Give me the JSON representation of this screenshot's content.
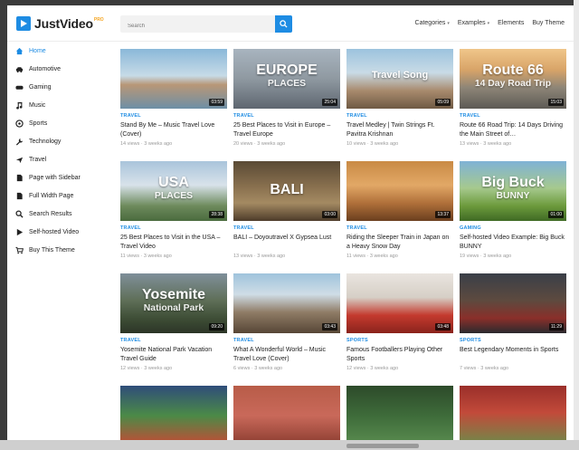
{
  "brand": {
    "name": "JustVideo",
    "badge": "PRO"
  },
  "search": {
    "placeholder": "Search"
  },
  "topnav": [
    {
      "label": "Categories",
      "dropdown": true
    },
    {
      "label": "Examples",
      "dropdown": true
    },
    {
      "label": "Elements",
      "dropdown": false
    },
    {
      "label": "Buy Theme",
      "dropdown": false
    }
  ],
  "sidebar": {
    "items": [
      {
        "label": "Home",
        "icon": "home-icon",
        "active": true
      },
      {
        "label": "Automotive",
        "icon": "car-icon"
      },
      {
        "label": "Gaming",
        "icon": "gamepad-icon"
      },
      {
        "label": "Music",
        "icon": "music-note-icon"
      },
      {
        "label": "Sports",
        "icon": "ball-icon"
      },
      {
        "label": "Technology",
        "icon": "wrench-icon"
      },
      {
        "label": "Travel",
        "icon": "plane-icon"
      },
      {
        "label": "Page with Sidebar",
        "icon": "document-icon"
      },
      {
        "label": "Full Width Page",
        "icon": "document-icon"
      },
      {
        "label": "Search Results",
        "icon": "search-icon"
      },
      {
        "label": "Self-hosted Video",
        "icon": "play-icon"
      },
      {
        "label": "Buy This Theme",
        "icon": "cart-icon"
      }
    ]
  },
  "videos": [
    {
      "category": "TRAVEL",
      "title": "Stand By Me – Music Travel Love (Cover)",
      "meta": "14 views · 3 weeks ago",
      "duration": "03:59",
      "bg": "linear-gradient(180deg,#8ab8d9 0%,#c7dbe7 45%,#b89777 60%,#6d8fa6 100%)",
      "overlay": ""
    },
    {
      "category": "TRAVEL",
      "title": "25 Best Places to Visit in Europe – Travel Europe",
      "meta": "20 views · 3 weeks ago",
      "duration": "25:04",
      "bg": "linear-gradient(180deg,#a8b4bf 0%,#8f99a1 50%,#5e6670 100%)",
      "overlay": "EUROPE|PLACES"
    },
    {
      "category": "TRAVEL",
      "title": "Travel Medley | Twin Strings Ft. Pavitra Krishnan",
      "meta": "10 views · 3 weeks ago",
      "duration": "05:09",
      "bg": "linear-gradient(180deg,#9cc3de 0%,#c9dbe6 40%,#a88a6d 70%,#6f5a44 100%)",
      "overlay": "Travel Song"
    },
    {
      "category": "TRAVEL",
      "title": "Route 66 Road Trip: 14 Days Driving the Main Street of…",
      "meta": "13 views · 3 weeks ago",
      "duration": "15:03",
      "bg": "linear-gradient(180deg,#f0c68a 0%,#d8a468 35%,#8d8577 65%,#5d5a55 100%)",
      "overlay": "Route 66|14 Day Road Trip"
    },
    {
      "category": "TRAVEL",
      "title": "25 Best Places to Visit in the USA – Travel Video",
      "meta": "11 views · 3 weeks ago",
      "duration": "28:38",
      "bg": "linear-gradient(180deg,#a9c4db 0%,#d8e2ea 40%,#6d8a5c 75%,#4a6b3e 100%)",
      "overlay": "USA|PLACES"
    },
    {
      "category": "TRAVEL",
      "title": "BALI – Doyoutravel X Gypsea Lust",
      "meta": "13 views · 3 weeks ago",
      "duration": "03:00",
      "bg": "linear-gradient(180deg,#5a4a35 0%,#8b7250 45%,#a48a62 70%,#4e3c2a 100%)",
      "overlay": "BALI"
    },
    {
      "category": "TRAVEL",
      "title": "Riding the Sleeper Train in Japan on a Heavy Snow Day",
      "meta": "11 views · 3 weeks ago",
      "duration": "13:37",
      "bg": "linear-gradient(180deg,#c98a45 0%,#e2a866 40%,#b0703a 70%,#6b3f1f 100%)",
      "overlay": ""
    },
    {
      "category": "GAMING",
      "title": "Self-hosted Video Example: Big Buck BUNNY",
      "meta": "19 views · 3 weeks ago",
      "duration": "01:00",
      "bg": "linear-gradient(180deg,#7fb2d6 0%,#a6c98e 45%,#6c9a3c 75%,#3f6a24 100%)",
      "overlay": "Big Buck|BUNNY"
    },
    {
      "category": "TRAVEL",
      "title": "Yosemite National Park Vacation Travel Guide",
      "meta": "12 views · 3 weeks ago",
      "duration": "09:20",
      "bg": "linear-gradient(180deg,#7f8f9a 0%,#5f6f58 45%,#3e4e36 75%,#2c3527 100%)",
      "overlay": "Yosemite|National Park"
    },
    {
      "category": "TRAVEL",
      "title": "What A Wonderful World – Music Travel Love (Cover)",
      "meta": "6 views · 3 weeks ago",
      "duration": "03:43",
      "bg": "linear-gradient(180deg,#9fc3dc 0%,#cfdde6 35%,#8f7c66 65%,#574636 100%)",
      "overlay": ""
    },
    {
      "category": "SPORTS",
      "title": "Famous Footballers Playing Other Sports",
      "meta": "12 views · 3 weeks ago",
      "duration": "03:48",
      "bg": "linear-gradient(180deg,#e9e4df 0%,#d6cfc6 40%,#c43a2e 70%,#8a231c 100%)",
      "overlay": ""
    },
    {
      "category": "SPORTS",
      "title": "Best Legendary Moments in Sports",
      "meta": "7 views · 3 weeks ago",
      "duration": "11:29",
      "bg": "linear-gradient(180deg,#3a3f48 0%,#5d4a3f 45%,#8a2f2a 75%,#2a2a2e 100%)",
      "overlay": ""
    },
    {
      "category": "",
      "title": "",
      "meta": "",
      "duration": "",
      "bg": "linear-gradient(180deg,#2f4d7a 0%,#4b8a47 50%,#c74a35 100%)",
      "overlay": ""
    },
    {
      "category": "",
      "title": "",
      "meta": "",
      "duration": "",
      "bg": "linear-gradient(180deg,#b85c48 0%,#c9695a 50%,#8a3c30 100%)",
      "overlay": ""
    },
    {
      "category": "",
      "title": "",
      "meta": "",
      "duration": "",
      "bg": "linear-gradient(180deg,#2d4a2a 0%,#3e6b3a 50%,#5a8c50 100%)",
      "overlay": ""
    },
    {
      "category": "",
      "title": "",
      "meta": "",
      "duration": "",
      "bg": "linear-gradient(180deg,#9a2f2a 0%,#c24a3a 45%,#6c8c4a 100%)",
      "overlay": ""
    }
  ]
}
